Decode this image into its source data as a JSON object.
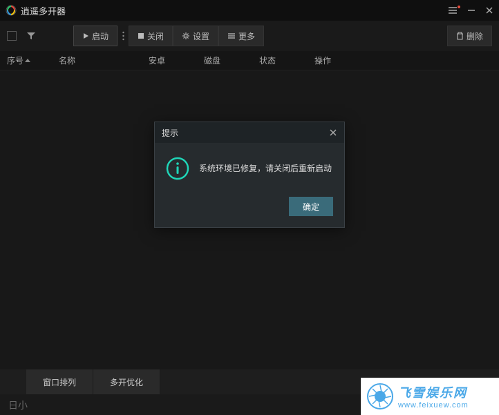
{
  "titlebar": {
    "app_title": "逍遥多开器"
  },
  "toolbar": {
    "start_label": "启动",
    "close_label": "关闭",
    "settings_label": "设置",
    "more_label": "更多",
    "delete_label": "删除"
  },
  "table": {
    "headers": {
      "seq": "序号",
      "name": "名称",
      "android": "安卓",
      "disk": "磁盘",
      "status": "状态",
      "ops": "操作"
    }
  },
  "modal": {
    "title": "提示",
    "message": "系统环境已修复，请关闭后重新启动",
    "ok_label": "确定"
  },
  "footer": {
    "arrange_label": "窗口排列",
    "optimize_label": "多开优化"
  },
  "watermark": {
    "title": "飞雪娱乐网",
    "url": "www.feixuew.com"
  },
  "bottom_fragment": "日小"
}
